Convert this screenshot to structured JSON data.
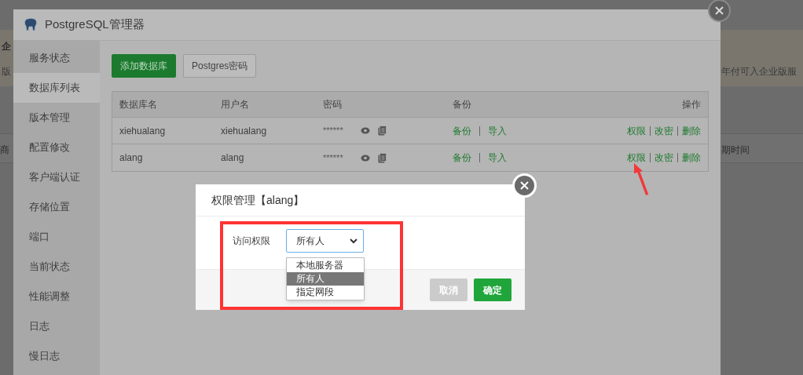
{
  "background_page": {
    "fragments": [
      "企",
      "版",
      "商",
      "年付可入企业版服",
      "期时间"
    ]
  },
  "window": {
    "title": "PostgreSQL管理器"
  },
  "sidebar": {
    "items": [
      {
        "label": "服务状态",
        "selected": false
      },
      {
        "label": "数据库列表",
        "selected": true
      },
      {
        "label": "版本管理",
        "selected": false
      },
      {
        "label": "配置修改",
        "selected": false
      },
      {
        "label": "客户端认证",
        "selected": false
      },
      {
        "label": "存储位置",
        "selected": false
      },
      {
        "label": "端口",
        "selected": false
      },
      {
        "label": "当前状态",
        "selected": false
      },
      {
        "label": "性能调整",
        "selected": false
      },
      {
        "label": "日志",
        "selected": false
      },
      {
        "label": "慢日志",
        "selected": false
      }
    ]
  },
  "toolbar": {
    "buttons": [
      {
        "label": "添加数据库",
        "kind": "primary"
      },
      {
        "label": "Postgres密码",
        "kind": "default"
      }
    ]
  },
  "table": {
    "columns": [
      "数据库名",
      "用户名",
      "密码",
      "备份",
      "操作"
    ],
    "rows": [
      {
        "database": "xiehualang",
        "user": "xiehualang",
        "password": "******",
        "backup_links": [
          "备份",
          "导入"
        ],
        "actions": [
          "权限",
          "改密",
          "删除"
        ]
      },
      {
        "database": "alang",
        "user": "alang",
        "password": "******",
        "backup_links": [
          "备份",
          "导入"
        ],
        "actions": [
          "权限",
          "改密",
          "删除"
        ]
      }
    ]
  },
  "dialog": {
    "title": "权限管理【alang】",
    "field": {
      "label": "访问权限",
      "value": "所有人",
      "expanded": true,
      "options": [
        {
          "label": "本地服务器",
          "selected": false
        },
        {
          "label": "所有人",
          "selected": true
        },
        {
          "label": "指定网段",
          "selected": false
        }
      ]
    },
    "buttons": [
      {
        "label": "取消",
        "kind": "secondary"
      },
      {
        "label": "确定",
        "kind": "primary"
      }
    ]
  }
}
